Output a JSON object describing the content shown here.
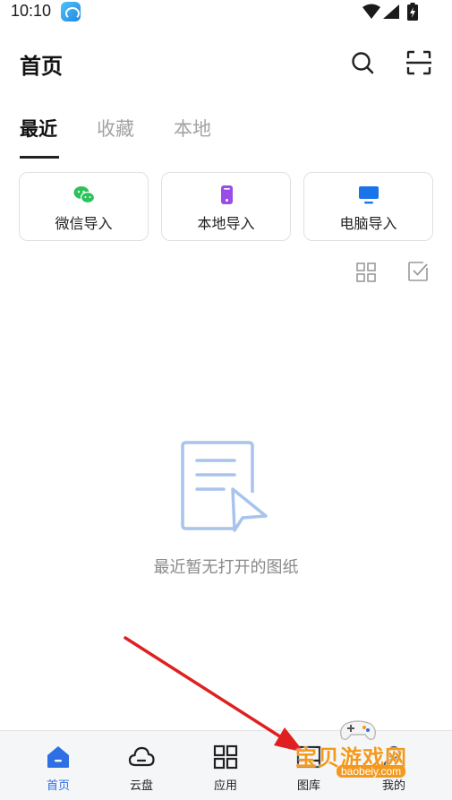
{
  "status_bar": {
    "time": "10:10"
  },
  "header": {
    "title": "首页"
  },
  "tabs": [
    {
      "label": "最近",
      "active": true
    },
    {
      "label": "收藏",
      "active": false
    },
    {
      "label": "本地",
      "active": false
    }
  ],
  "import_cards": [
    {
      "label": "微信导入",
      "icon": "wechat-icon",
      "color": "#2dc15b"
    },
    {
      "label": "本地导入",
      "icon": "phone-icon",
      "color": "#9b4be8"
    },
    {
      "label": "电脑导入",
      "icon": "monitor-icon",
      "color": "#1a73e8"
    }
  ],
  "empty_state": {
    "message": "最近暂无打开的图纸"
  },
  "bottom_nav": [
    {
      "label": "首页",
      "icon": "home-icon",
      "active": true
    },
    {
      "label": "云盘",
      "icon": "cloud-icon",
      "active": false
    },
    {
      "label": "应用",
      "icon": "apps-grid-icon",
      "active": false
    },
    {
      "label": "图库",
      "icon": "gallery-icon",
      "active": false
    },
    {
      "label": "我的",
      "icon": "profile-icon",
      "active": false
    }
  ],
  "watermark": {
    "title": "宝贝游戏网",
    "url": "baobeiy.com"
  },
  "colors": {
    "accent": "#2f6fe4",
    "arrow": "#e02020",
    "watermark": "#f39a1e"
  }
}
